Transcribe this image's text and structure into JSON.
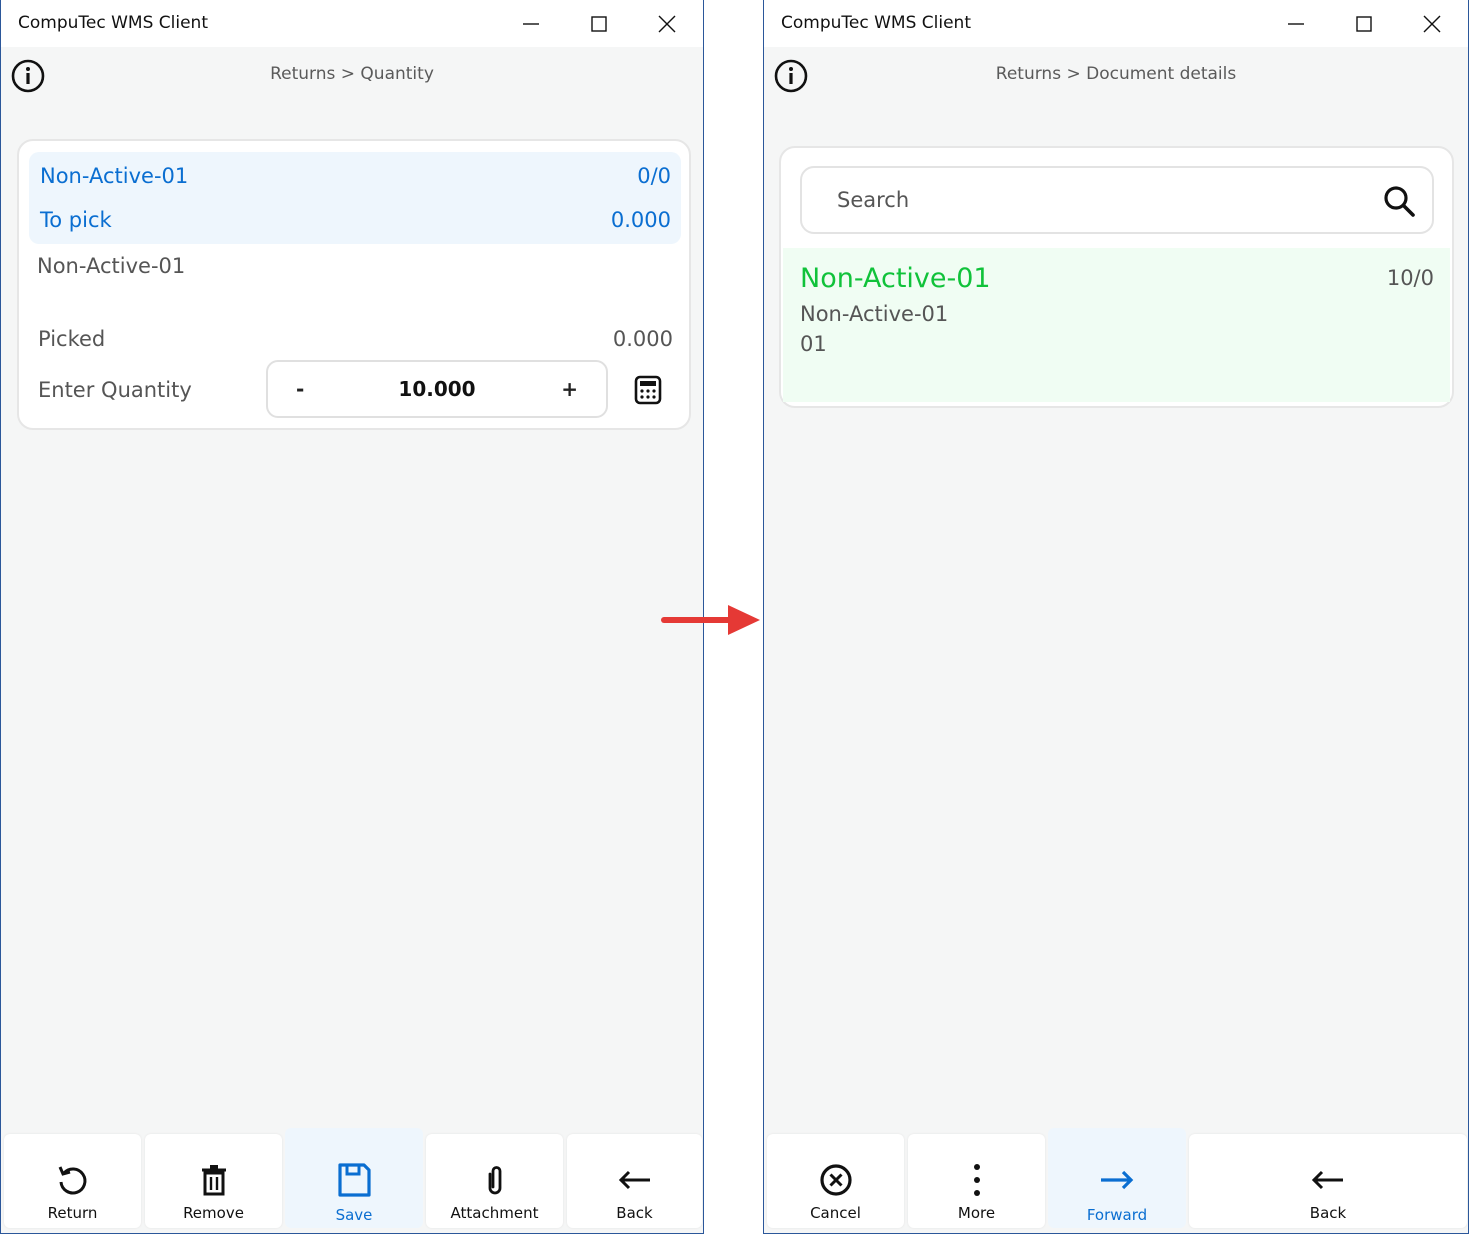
{
  "left_window": {
    "title": "CompuTec WMS Client",
    "breadcrumb": "Returns > Quantity",
    "item": {
      "name": "Non-Active-01",
      "ratio": "0/0",
      "to_pick_label": "To pick",
      "to_pick_value": "0.000",
      "description": "Non-Active-01",
      "picked_label": "Picked",
      "picked_value": "0.000",
      "enter_qty_label": "Enter Quantity",
      "qty_minus": "-",
      "qty_value": "10.000",
      "qty_plus": "+"
    },
    "toolbar": [
      {
        "label": "Return",
        "icon": "refresh-icon",
        "active": false
      },
      {
        "label": "Remove",
        "icon": "trash-icon",
        "active": false
      },
      {
        "label": "Save",
        "icon": "save-icon",
        "active": true
      },
      {
        "label": "Attachment",
        "icon": "paperclip-icon",
        "active": false
      },
      {
        "label": "Back",
        "icon": "arrow-left-icon",
        "active": false
      }
    ]
  },
  "right_window": {
    "title": "CompuTec WMS Client",
    "breadcrumb": "Returns > Document details",
    "search": {
      "placeholder": "Search"
    },
    "document": {
      "name": "Non-Active-01",
      "count": "10/0",
      "line2": "Non-Active-01",
      "line3": "01"
    },
    "toolbar": [
      {
        "label": "Cancel",
        "icon": "cancel-circle-icon",
        "active": false
      },
      {
        "label": "More",
        "icon": "more-vertical-icon",
        "active": false
      },
      {
        "label": "Forward",
        "icon": "arrow-right-icon",
        "active": true
      },
      {
        "label": "Back",
        "icon": "arrow-left-icon",
        "active": false
      }
    ]
  },
  "colors": {
    "accent_blue": "#0a6ed1",
    "accent_green": "#10c23a",
    "arrow_red": "#e53935",
    "highlight_blue": "#eef6fd",
    "highlight_green": "#f0fdf3"
  }
}
